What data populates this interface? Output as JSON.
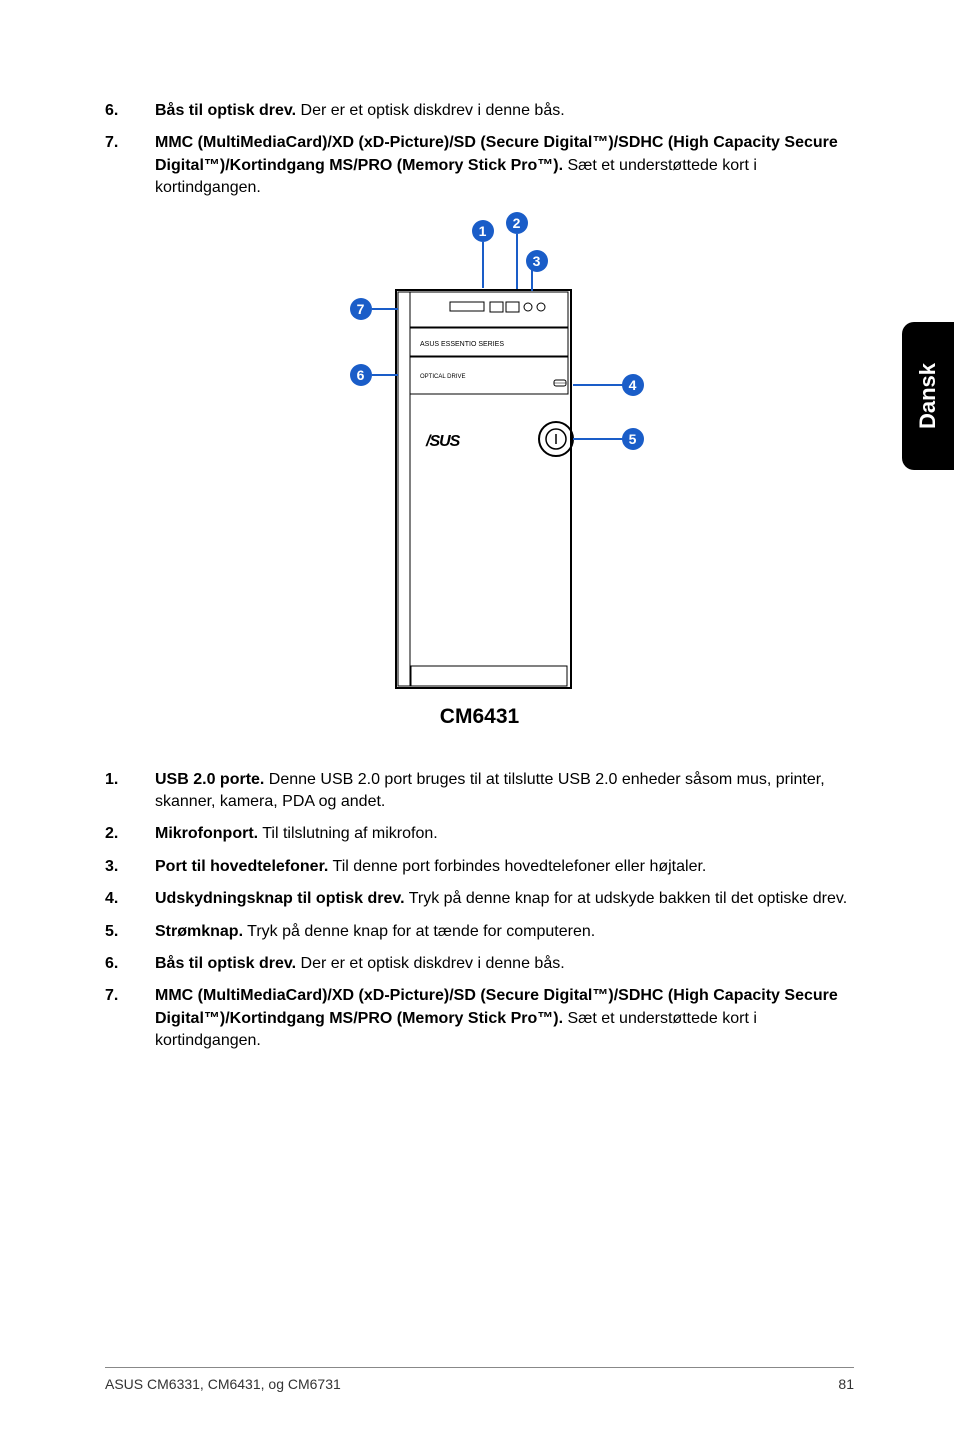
{
  "side_tab": "Dansk",
  "model": "CM6431",
  "top_items": [
    {
      "num": "6.",
      "label": "Bås til optisk drev.",
      "text": " Der er et optisk diskdrev i denne bås."
    },
    {
      "num": "7.",
      "label": "MMC (MultiMediaCard)/XD (xD-Picture)/SD (Secure Digital™)/SDHC (High Capacity Secure Digital™)/Kortindgang MS/PRO (Memory Stick Pro™).",
      "text": " Sæt et understøttede kort i kortindgangen."
    }
  ],
  "callouts": {
    "1": "1",
    "2": "2",
    "3": "3",
    "4": "4",
    "5": "5",
    "6": "6",
    "7": "7"
  },
  "bottom_items": [
    {
      "num": "1.",
      "label": "USB 2.0 porte.",
      "text": " Denne USB 2.0 port bruges til at tilslutte USB 2.0 enheder såsom mus, printer, skanner, kamera, PDA og andet."
    },
    {
      "num": "2.",
      "label": "Mikrofonport.",
      "text": " Til tilslutning af mikrofon."
    },
    {
      "num": "3.",
      "label": "Port til hovedtelefoner.",
      "text": " Til denne port forbindes hovedtelefoner eller højtaler."
    },
    {
      "num": "4.",
      "label": "Udskydningsknap til optisk drev.",
      "text": " Tryk på denne knap for at udskyde bakken til det optiske drev."
    },
    {
      "num": "5.",
      "label": "Strømknap.",
      "text": " Tryk på denne knap for at tænde for computeren."
    },
    {
      "num": "6.",
      "label": "Bås til optisk drev.",
      "text": " Der er et optisk diskdrev i denne bås."
    },
    {
      "num": "7.",
      "label": "MMC (MultiMediaCard)/XD (xD-Picture)/SD (Secure Digital™)/SDHC (High Capacity Secure Digital™)/Kortindgang MS/PRO (Memory Stick Pro™).",
      "text": " Sæt et understøttede kort i kortindgangen."
    }
  ],
  "footer_left": "ASUS CM6331, CM6431, og CM6731",
  "footer_right": "81"
}
